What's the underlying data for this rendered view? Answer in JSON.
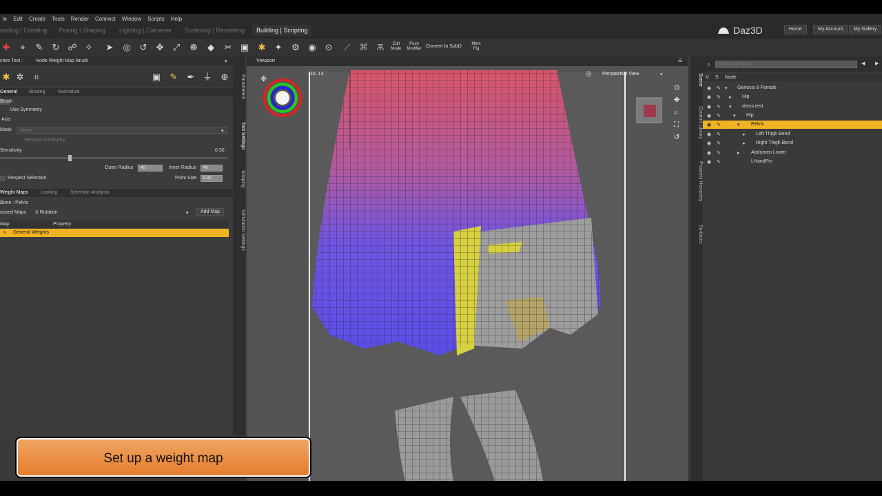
{
  "menu": [
    "le",
    "Edit",
    "Create",
    "Tools",
    "Render",
    "Connect",
    "Window",
    "Scripts",
    "Help"
  ],
  "workspace_tabs": [
    "oading | Creating",
    "Posing | Shaping",
    "Lighting | Cameras",
    "Surfacing | Rendering",
    "Building | Scripting"
  ],
  "brand": "Daz3D",
  "top_buttons": [
    "Home",
    "My Account",
    "My Gallery"
  ],
  "toolbar": {
    "edit_mode": "Edit\nMode",
    "push": "Push\nModifier",
    "convert": "Convert to SubD",
    "mem_fig": "Mem\nFig"
  },
  "left": {
    "active_tool_label": "ctive Tool :",
    "active_tool": "Node Weight Map Brush",
    "tabs": [
      "General",
      "Binding",
      "Normalize"
    ],
    "use_symmetry": "Use Symmetry",
    "brush": "Brush",
    "axis": "Axis",
    "mask": "Mask",
    "mask_value": "None",
    "respect_geo": "Respect Geometry",
    "sensitivity": "Sensitivity",
    "sensitivity_value": "0.30",
    "outer_radius": "Outer Radius",
    "outer_radius_value": "40",
    "inner_radius": "Inner Radius",
    "inner_radius_value": "40",
    "point_size": "Point Size",
    "point_size_value": "5.00",
    "respect_selection": "Respect Selection",
    "map_tabs": [
      "Weight Maps",
      "Locking",
      "Selection Analysis"
    ],
    "bone": "Bone : Pelvis",
    "unused_maps": "nused Maps",
    "unused_value": "X Rotation",
    "add_map": "Add Map",
    "col_map": "Map",
    "col_property": "Property",
    "general_weights": "General Weights"
  },
  "side_tabs_left": [
    "Parameters",
    "Tool Settings",
    "Shaping",
    "Simulation Settings"
  ],
  "viewport": {
    "tab": "Viewport",
    "coords": "10, 13",
    "view": "Perspective View"
  },
  "side_tabs_right": [
    "Scene",
    "Content Library",
    "Property Hierarchy",
    "Surfaces"
  ],
  "scene": {
    "search_placeholder": "Enter text to filter by...",
    "col_v": "V",
    "col_s": "S",
    "col_node": "Node",
    "nodes": [
      "Genesis 8 Female",
      "Hip",
      "dress test",
      "Hip",
      "Pelvis",
      "Left Thigh Bend",
      "Right Thigh Bend",
      "Abdomen Lower",
      "LHandPin"
    ]
  },
  "caption": "Set up a weight map",
  "colors": {
    "highlight": "#f0b422",
    "caption": "#e8893a"
  }
}
